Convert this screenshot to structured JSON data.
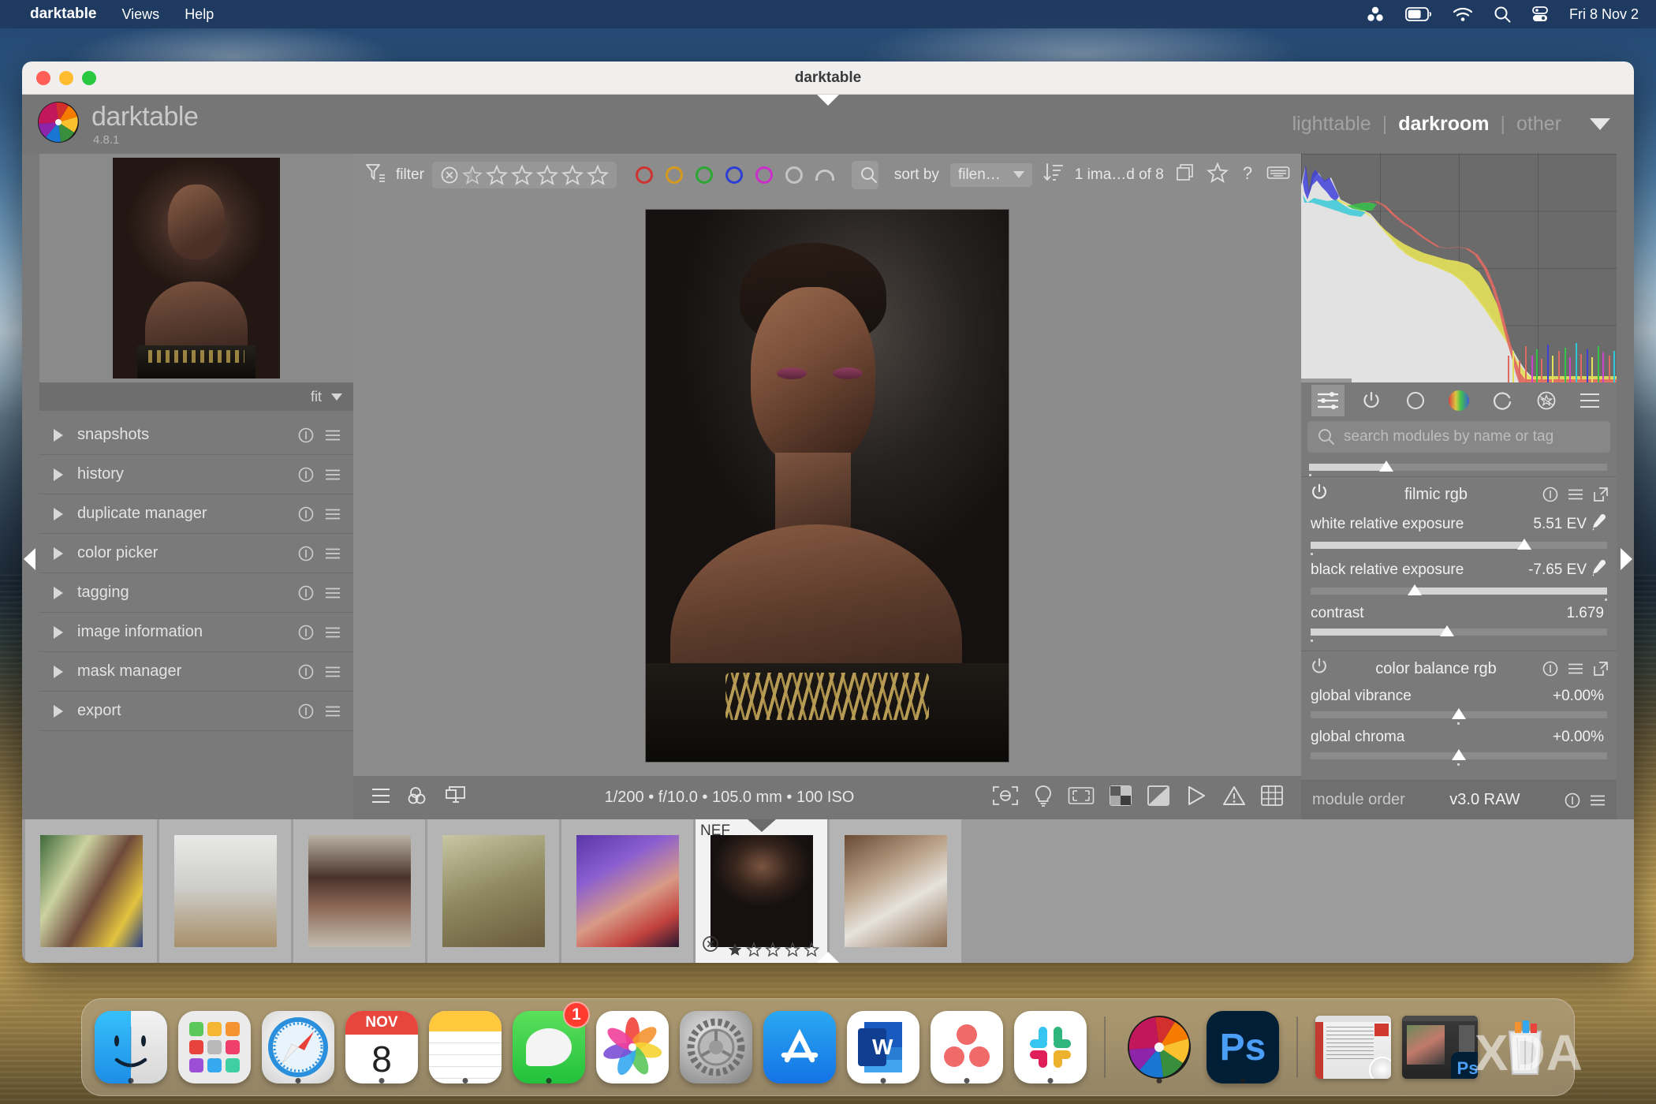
{
  "menubar": {
    "apple_label": "darktable",
    "items": [
      "Views",
      "Help"
    ],
    "status_icons": [
      "asana-menu-icon",
      "battery-icon",
      "wifi-icon",
      "spotlight-search-icon",
      "control-center-icon"
    ],
    "clock": "Fri 8 Nov  2"
  },
  "window": {
    "title": "darktable",
    "traffic_lights": [
      "close-button",
      "minimize-button",
      "maximize-button"
    ]
  },
  "header": {
    "brand": "darktable",
    "version": "4.8.1",
    "logo_icon": "darktable-aperture-logo",
    "views": [
      {
        "label": "lighttable",
        "active": false
      },
      {
        "label": "darkroom",
        "active": true
      },
      {
        "label": "other",
        "active": false
      }
    ],
    "view_separator": "|",
    "dropdown_icon": "chevron-down-icon"
  },
  "filterbar": {
    "filter_icon": "filter-funnel-icon",
    "filter_label": "filter",
    "reject_icon": "reject-circle-x-icon",
    "half_star_icon": "half-star-icon",
    "star_count": 5,
    "color_labels": [
      "#d0332f",
      "#d69b1c",
      "#2aa832",
      "#2b3fd4",
      "#cc2ecc",
      "#c4c4c4"
    ],
    "arc_icon": "color-label-arc-icon",
    "search_icon": "search-icon",
    "search_value": "",
    "search_placeholder": "",
    "sort_by_label": "sort by",
    "sort_value": "filen…",
    "sort_caret_icon": "chevron-down-icon",
    "sort_order_icon": "sort-descending-icon",
    "image_count": "1 ima…d of 8",
    "group_icon": "grouping-icon",
    "overlays_icon": "star-overlays-icon",
    "help_icon": "help-question-icon",
    "shortcuts_icon": "keyboard-shortcuts-icon",
    "preferences_icon": "gear-icon"
  },
  "navigation": {
    "zoom_level": "fit",
    "zoom_caret_icon": "chevron-down-icon",
    "preview_name": "navigation-preview-thumbnail"
  },
  "left_modules": [
    {
      "label": "snapshots",
      "expanded": false
    },
    {
      "label": "history",
      "expanded": false
    },
    {
      "label": "duplicate manager",
      "expanded": false
    },
    {
      "label": "color picker",
      "expanded": false
    },
    {
      "label": "tagging",
      "expanded": false
    },
    {
      "label": "image information",
      "expanded": false
    },
    {
      "label": "mask manager",
      "expanded": false
    },
    {
      "label": "export",
      "expanded": false
    }
  ],
  "left_module_icons": {
    "reset": "reset-info-icon",
    "presets": "presets-hamburger-icon",
    "expand": "expand-triangle-icon"
  },
  "histogram": {
    "name": "histogram-panel",
    "mode": "rgb-overlaid",
    "grid_divisions": 4,
    "channels": [
      "red",
      "green",
      "blue",
      "luminance"
    ]
  },
  "module_tabs": [
    {
      "icon": "active-modules-sliders-icon",
      "active": true
    },
    {
      "icon": "base-modules-power-icon",
      "active": false
    },
    {
      "icon": "tone-modules-circle-icon",
      "active": false
    },
    {
      "icon": "color-modules-rgb-icon",
      "active": false
    },
    {
      "icon": "correction-modules-arc-icon",
      "active": false
    },
    {
      "icon": "effects-modules-star-icon",
      "active": false
    },
    {
      "icon": "module-presets-hamburger-icon",
      "active": false
    }
  ],
  "module_search": {
    "placeholder": "search modules by name or tag",
    "value": "",
    "icon": "search-icon"
  },
  "partial_slider": {
    "fill_pct": 26
  },
  "right_modules": [
    {
      "name": "filmic rgb",
      "power_icon": "module-power-icon",
      "icons": [
        "reset-info-icon",
        "presets-hamburger-icon",
        "multi-instance-icon"
      ],
      "params": [
        {
          "label": "white relative exposure",
          "value": "5.51 EV",
          "fill_pct": 72,
          "knob_pct": 72,
          "picker": true
        },
        {
          "label": "black relative exposure",
          "value": "-7.65 EV",
          "fill_pct": 100,
          "knob_pct": 35,
          "picker": true
        },
        {
          "label": "contrast",
          "value": "1.679",
          "fill_pct": 46,
          "knob_pct": 46,
          "picker": false
        }
      ]
    },
    {
      "name": "color balance rgb",
      "power_icon": "module-power-icon",
      "icons": [
        "reset-info-icon",
        "presets-hamburger-icon",
        "multi-instance-icon"
      ],
      "params": [
        {
          "label": "global vibrance",
          "value": "+0.00%",
          "fill_pct": 0,
          "knob_pct": 50,
          "picker": false
        },
        {
          "label": "global chroma",
          "value": "+0.00%",
          "fill_pct": 0,
          "knob_pct": 50,
          "picker": false
        }
      ]
    }
  ],
  "module_order": {
    "label": "module order",
    "value": "v3.0 RAW",
    "icons": [
      "reset-info-icon",
      "presets-hamburger-icon"
    ]
  },
  "bottombar": {
    "left_icons": [
      "history-hamburger-icon",
      "duplicate-overlap-icon",
      "second-window-icon"
    ],
    "exif": "1/200 • f/10.0 • 105.0 mm • 100 ISO",
    "right_icons": [
      "focus-peaking-icon",
      "lights-bulb-icon",
      "raw-overexposed-icon",
      "gamut-check-icon",
      "overexposure-indication-icon",
      "color-assessment-icon",
      "warning-triangle-icon",
      "guide-overlay-grid-icon"
    ]
  },
  "filmstrip": {
    "cells": [
      {
        "id": "thumb-1",
        "selected": false,
        "tag": "",
        "rating": 0,
        "art": "t1"
      },
      {
        "id": "thumb-2",
        "selected": false,
        "tag": "",
        "rating": 0,
        "art": "t2"
      },
      {
        "id": "thumb-3",
        "selected": false,
        "tag": "",
        "rating": 0,
        "art": "t3"
      },
      {
        "id": "thumb-4",
        "selected": false,
        "tag": "",
        "rating": 0,
        "art": "t4"
      },
      {
        "id": "thumb-5",
        "selected": false,
        "tag": "",
        "rating": 0,
        "art": "t5"
      },
      {
        "id": "thumb-6",
        "selected": true,
        "tag": "NEF",
        "rating": 1,
        "art": "t6"
      },
      {
        "id": "thumb-7",
        "selected": false,
        "tag": "",
        "rating": 0,
        "art": "t7"
      }
    ]
  },
  "canvas": {
    "image_name": "portrait-photograph"
  },
  "dock": {
    "items": [
      {
        "name": "finder",
        "badge": null,
        "running": true
      },
      {
        "name": "launchpad",
        "badge": null,
        "running": false
      },
      {
        "name": "safari",
        "badge": null,
        "running": true
      },
      {
        "name": "calendar",
        "badge": null,
        "running": true,
        "month": "NOV",
        "day": "8"
      },
      {
        "name": "notes",
        "badge": null,
        "running": true
      },
      {
        "name": "messages",
        "badge": "1",
        "running": true
      },
      {
        "name": "photos",
        "badge": null,
        "running": false
      },
      {
        "name": "system-settings",
        "badge": null,
        "running": false
      },
      {
        "name": "app-store",
        "badge": null,
        "running": false
      },
      {
        "name": "microsoft-word",
        "badge": null,
        "running": true
      },
      {
        "name": "asana",
        "badge": null,
        "running": true
      },
      {
        "name": "slack",
        "badge": null,
        "running": true
      },
      {
        "name": "darktable",
        "badge": null,
        "running": true
      },
      {
        "name": "photoshop",
        "badge": null,
        "running": true
      },
      {
        "name": "minimized-word-window",
        "badge": null,
        "running": false
      },
      {
        "name": "minimized-photoshop-window",
        "badge": null,
        "running": false
      },
      {
        "name": "trash",
        "badge": null,
        "running": false
      }
    ]
  },
  "watermark": {
    "text": "XDA"
  }
}
